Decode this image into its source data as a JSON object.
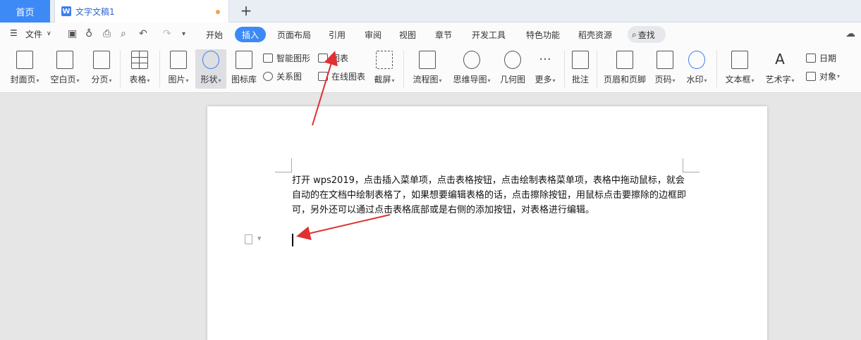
{
  "tabs": {
    "home": "首页",
    "doc_title": "文字文稿1",
    "add": "+"
  },
  "menu": {
    "file": "文件",
    "tabs": [
      "开始",
      "插入",
      "页面布局",
      "引用",
      "审阅",
      "视图",
      "章节",
      "开发工具",
      "特色功能",
      "稻壳资源"
    ],
    "active_tab": "插入",
    "search": "查找"
  },
  "ribbon": {
    "cover": "封面页",
    "blank": "空白页",
    "pagebreak": "分页",
    "table": "表格",
    "picture": "图片",
    "shape": "形状",
    "iconlib": "图标库",
    "smartart": "智能图形",
    "chart": "图表",
    "relation": "关系图",
    "onlinechart": "在线图表",
    "screenshot": "截屏",
    "flowchart": "流程图",
    "mindmap": "思维导图",
    "geometry": "几何图",
    "more": "更多",
    "comment": "批注",
    "headerfooter": "页眉和页脚",
    "pagenum": "页码",
    "watermark": "水印",
    "textbox": "文本框",
    "wordart": "艺术字",
    "date": "日期",
    "object": "对象"
  },
  "document": {
    "paragraph": "打开 wps2019，点击插入菜单项，点击表格按钮，点击绘制表格菜单项，表格中拖动鼠标，就会自动的在文档中绘制表格了，如果想要编辑表格的话，点击擦除按钮，用鼠标点击要擦除的边框即可，另外还可以通过点击表格底部或是右侧的添加按钮，对表格进行编辑。"
  },
  "colors": {
    "accent": "#3d8af7",
    "arrow": "#e03030"
  }
}
